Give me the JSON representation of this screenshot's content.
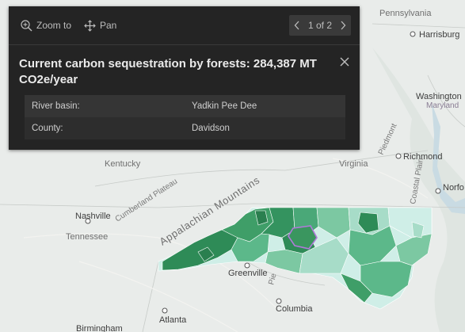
{
  "popup": {
    "zoom_label": "Zoom to",
    "pan_label": "Pan",
    "pager_text": "1 of 2",
    "title": "Current carbon sequestration by forests: 284,387 MT CO2e/year",
    "rows": [
      {
        "field": "River basin:",
        "value": "Yadkin Pee Dee"
      },
      {
        "field": "County:",
        "value": "Davidson"
      }
    ]
  },
  "map_labels": {
    "pennsylvania": "Pennsylvania",
    "harrisburg": "Harrisburg",
    "washington": "Washington",
    "maryland": "Maryland",
    "kentucky": "Kentucky",
    "virginia": "Virginia",
    "richmond": "Richmond",
    "piedmont": "Piedmont",
    "coastal_plain": "Coastal Plain",
    "norfolk": "Norfo",
    "nashville": "Nashville",
    "tennessee": "Tennessee",
    "cumberland_plateau": "Cumberland Plateau",
    "appalachian_mountains": "Appalachian Mountains",
    "greenville": "Greenville",
    "piedmont_small": "Pie",
    "columbia": "Columbia",
    "atlanta": "Atlanta",
    "birmingham": "Birmingham"
  },
  "colors": {
    "popup_bg": "#242424",
    "land": "#e9ecea",
    "water": "#c9dbe3",
    "choropleth_dark": "#2e8b57",
    "choropleth_mid": "#5cb88a",
    "choropleth_light": "#a7dcc8",
    "choropleth_pale": "#cfeee7",
    "highlight": "#b07ad9"
  }
}
